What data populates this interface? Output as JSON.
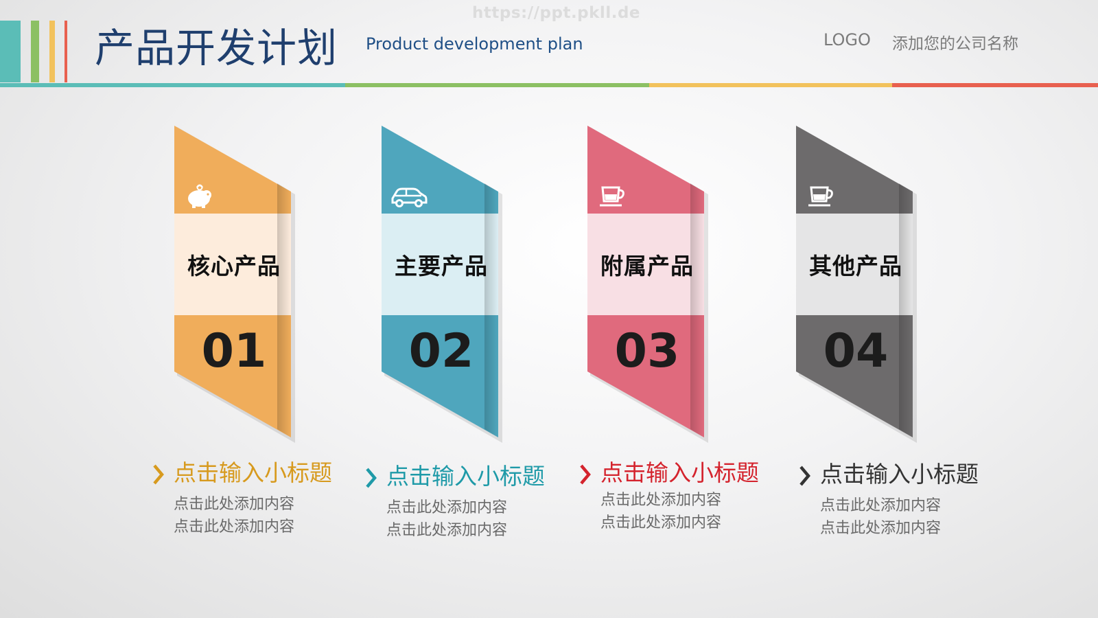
{
  "watermark": "https://ppt.pkll.de",
  "header": {
    "title_cn": "产品开发计划",
    "title_en": "Product development plan",
    "logo": "LOGO",
    "company": "添加您的公司名称",
    "stripe_colors": [
      "#5bbdb7",
      "#8cc063",
      "#f2c25c",
      "#e8604f"
    ],
    "line_colors": [
      "#5bbdb7",
      "#8cc063",
      "#f2c25c",
      "#e8604f"
    ]
  },
  "cards": [
    {
      "icon": "piggy-bank-icon",
      "label": "核心产品",
      "number": "01",
      "color": "#f0ad5b",
      "light": "#fdecdc",
      "subtitle": "点击输入小标题",
      "subtitle_color": "#d79a1e",
      "desc1": "点击此处添加内容",
      "desc2": "点击此处添加内容"
    },
    {
      "icon": "car-icon",
      "label": "主要产品",
      "number": "02",
      "color": "#4fa6bd",
      "light": "#dbeef3",
      "subtitle": "点击输入小标题",
      "subtitle_color": "#1f9aa8",
      "desc1": "点击此处添加内容",
      "desc2": "点击此处添加内容"
    },
    {
      "icon": "coffee-cup-icon",
      "label": "附属产品",
      "number": "03",
      "color": "#e06a7d",
      "light": "#f8dfe4",
      "subtitle": "点击输入小标题",
      "subtitle_color": "#d4232d",
      "desc1": "点击此处添加内容",
      "desc2": "点击此处添加内容"
    },
    {
      "icon": "coffee-cup-icon",
      "label": "其他产品",
      "number": "04",
      "color": "#6d6b6c",
      "light": "#e5e5e6",
      "subtitle": "点击输入小标题",
      "subtitle_color": "#333333",
      "desc1": "点击此处添加内容",
      "desc2": "点击此处添加内容"
    }
  ]
}
